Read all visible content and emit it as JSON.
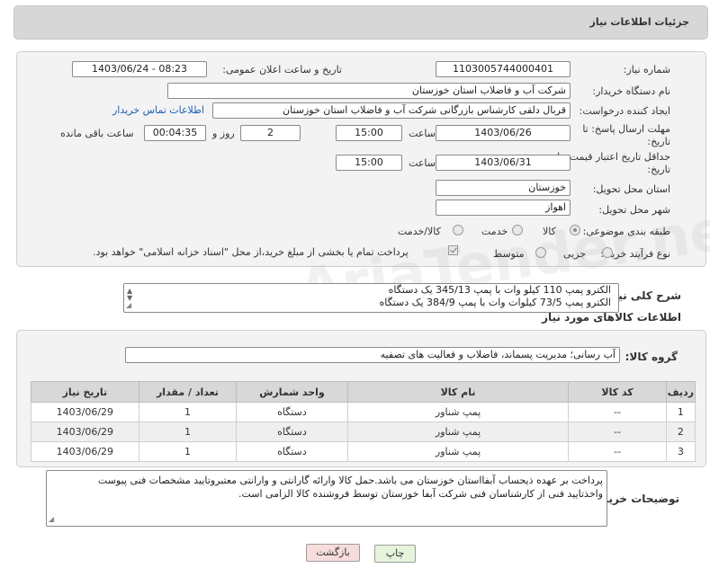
{
  "header": {
    "title": "جزئیات اطلاعات نیاز"
  },
  "form": {
    "need_number_label": "شماره نیاز:",
    "need_number": "1103005744000401",
    "announce_label": "تاریخ و ساعت اعلان عمومی:",
    "announce_value": "1403/06/24 - 08:23",
    "buyer_org_label": "نام دستگاه خریدار:",
    "buyer_org": "شرکت آب و فاضلاب استان خوزستان",
    "creator_label": "ایجاد کننده درخواست:",
    "creator": "قربال دلقی کارشناس بازرگانی شرکت آب و فاضلاب استان خوزستان",
    "contact_link": "اطلاعات تماس خریدار",
    "deadline_label_1": "مهلت ارسال پاسخ: تا",
    "deadline_label_2": "تاریخ:",
    "deadline_date": "1403/06/26",
    "time_label": "ساعت",
    "deadline_time": "15:00",
    "days_value": "2",
    "days_label": "روز و",
    "remaining_value": "00:04:35",
    "remaining_label": "ساعت باقی مانده",
    "validity_label_1": "حداقل تاریخ اعتبار قیمت: تا",
    "validity_label_2": "تاریخ:",
    "validity_date": "1403/06/31",
    "validity_time": "15:00",
    "province_label": "استان محل تحویل:",
    "province": "خوزستان",
    "city_label": "شهر محل تحویل:",
    "city": "اهواز",
    "category_label": "طبقه بندی موضوعی:",
    "category_goods": "کالا",
    "category_service": "خدمت",
    "category_both": "کالا/خدمت",
    "process_label": "نوع فرآیند خرید :",
    "process_minor": "جزیی",
    "process_medium": "متوسط",
    "payment_note": "پرداخت تمام یا بخشی از مبلغ خرید،از محل \"اسناد خزانه اسلامی\" خواهد بود."
  },
  "description": {
    "label": "شرح کلی نیاز:",
    "line1": "الکترو پمپ 110 کیلو وات با پمپ 345/13 یک دستگاه",
    "line2": "الکترو پمپ 73/5 کیلوات وات با پمپ 384/9 یک دستگاه"
  },
  "goods_section": {
    "title": "اطلاعات کالاهای مورد نیاز",
    "group_label": "گروه کالا:",
    "group_value": "آب رسانی؛ مدیریت پسماند، فاضلاب و فعالیت های تصفیه"
  },
  "table": {
    "headers": [
      "ردیف",
      "کد کالا",
      "نام کالا",
      "واحد شمارش",
      "تعداد / مقدار",
      "تاریخ نیاز"
    ],
    "rows": [
      [
        "1",
        "--",
        "پمپ شناور",
        "دستگاه",
        "1",
        "1403/06/29"
      ],
      [
        "2",
        "--",
        "پمپ شناور",
        "دستگاه",
        "1",
        "1403/06/29"
      ],
      [
        "3",
        "--",
        "پمپ شناور",
        "دستگاه",
        "1",
        "1403/06/29"
      ]
    ]
  },
  "buyer_notes": {
    "label": "توضیحات خریدار:",
    "line1": "پرداخت بر عهده ذیحساب آبفااستان خوزستان می باشد.حمل کالا وارائه گارانتی و وارانتی معتبروتایید مشخصات فنی پیوست",
    "line2": "واخذتایید فنی از کارشناسان فنی شرکت آبفا خوزستان توسط فروشنده کالا الزامی است."
  },
  "buttons": {
    "print": "چاپ",
    "back": "بازگشت"
  },
  "watermark": "AriaTender.net",
  "colors": {
    "link": "#1b5fb5",
    "back_button": "#f7dcdc",
    "print_button": "#e6f4dc"
  }
}
